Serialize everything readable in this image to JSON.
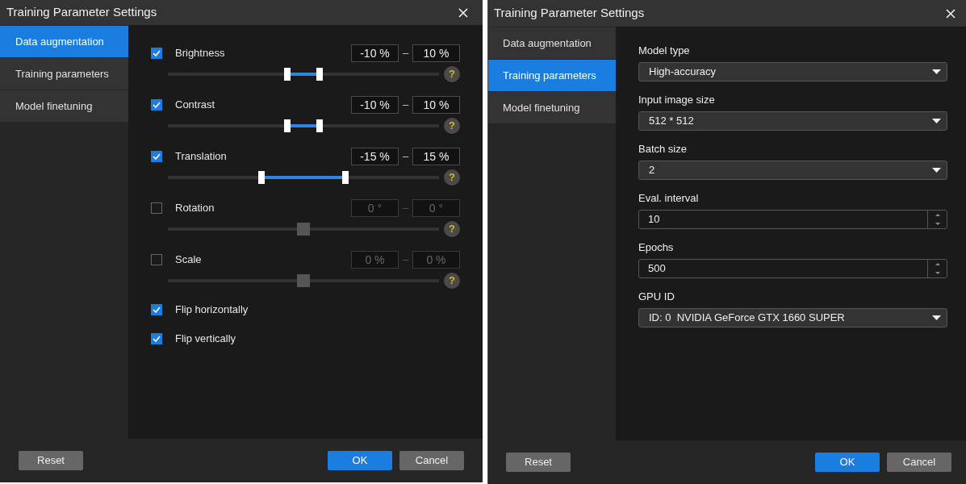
{
  "dialogs": [
    {
      "title": "Training Parameter Settings",
      "sidebar": [
        {
          "label": "Data augmentation",
          "selected": true
        },
        {
          "label": "Training parameters",
          "selected": false
        },
        {
          "label": "Model finetuning",
          "selected": false
        }
      ],
      "panel": {
        "kind": "augmentation",
        "rows": [
          {
            "kind": "range",
            "label": "Brightness",
            "checked": true,
            "from": "-10 %",
            "separator": "–",
            "to": "10 %",
            "thumbs": [
              {
                "level": 0.44
              },
              {
                "level": 0.56
              }
            ],
            "help": "?"
          },
          {
            "kind": "range",
            "label": "Contrast",
            "checked": true,
            "from": "-10 %",
            "separator": "–",
            "to": "10 %",
            "thumbs": [
              {
                "level": 0.44
              },
              {
                "level": 0.56
              }
            ],
            "help": "?"
          },
          {
            "kind": "range",
            "label": "Translation",
            "checked": true,
            "from": "-15 %",
            "separator": "–",
            "to": "15 %",
            "thumbs": [
              {
                "level": 0.345
              },
              {
                "level": 0.655
              }
            ],
            "help": "?"
          },
          {
            "kind": "range",
            "label": "Rotation",
            "checked": false,
            "from": "0 °",
            "separator": "–",
            "to": "0 °",
            "thumbs": [
              {
                "level": 0.5
              }
            ],
            "help": "?"
          },
          {
            "kind": "range",
            "label": "Scale",
            "checked": false,
            "from": "0 %",
            "separator": "–",
            "to": "0 %",
            "thumbs": [
              {
                "level": 0.5
              }
            ],
            "help": "?"
          },
          {
            "kind": "check",
            "label": "Flip horizontally",
            "checked": true
          },
          {
            "kind": "check",
            "label": "Flip vertically",
            "checked": true
          }
        ]
      },
      "footer": {
        "left": [
          {
            "label": "Reset",
            "kind": "secondary"
          }
        ],
        "right": [
          {
            "label": "OK",
            "kind": "primary"
          },
          {
            "label": "Cancel",
            "kind": "secondary"
          }
        ]
      }
    },
    {
      "title": "Training Parameter Settings",
      "sidebar": [
        {
          "label": "Data augmentation",
          "selected": false
        },
        {
          "label": "Training parameters",
          "selected": true
        },
        {
          "label": "Model finetuning",
          "selected": false
        }
      ],
      "panel": {
        "kind": "parameters",
        "fields": [
          {
            "kind": "select",
            "label": "Model type",
            "value": "High-accuracy"
          },
          {
            "kind": "select",
            "label": "Input image size",
            "value": "512 * 512"
          },
          {
            "kind": "select",
            "label": "Batch size",
            "value": "2"
          },
          {
            "kind": "spin",
            "label": "Eval. interval",
            "value": "10"
          },
          {
            "kind": "spin",
            "label": "Epochs",
            "value": "500"
          },
          {
            "kind": "select",
            "label": "GPU ID",
            "value": "ID: 0  NVIDIA GeForce GTX 1660 SUPER"
          }
        ]
      },
      "footer": {
        "left": [
          {
            "label": "Reset",
            "kind": "secondary"
          }
        ],
        "right": [
          {
            "label": "OK",
            "kind": "primary"
          },
          {
            "label": "Cancel",
            "kind": "secondary"
          }
        ]
      }
    }
  ]
}
